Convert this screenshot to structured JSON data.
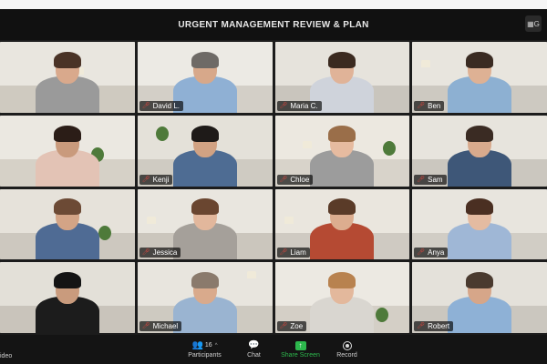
{
  "window": {
    "title": "URGENT MANAGEMENT REVIEW & PLAN",
    "view_button_label": "G"
  },
  "participants": [
    {
      "name": "",
      "muted": false,
      "active": false,
      "wall": "#e9e6df",
      "floor": "#cfcac0",
      "skin": "#d9a98c",
      "hair": "#4a3326",
      "shirt": "#9a9a9a"
    },
    {
      "name": "David L.",
      "muted": true,
      "active": true,
      "wall": "#eceae4",
      "floor": "#d3cfc7",
      "skin": "#d7a88a",
      "hair": "#6e6a66",
      "shirt": "#8fb0d4"
    },
    {
      "name": "Maria C.",
      "muted": true,
      "active": false,
      "wall": "#e6e3dc",
      "floor": "#c9c5bd",
      "skin": "#e0b398",
      "hair": "#3b2a20",
      "shirt": "#cfd3db"
    },
    {
      "name": "Ben",
      "muted": true,
      "active": false,
      "wall": "#e8e5de",
      "floor": "#cdc9c1",
      "skin": "#deb194",
      "hair": "#3a2b22",
      "shirt": "#8db0d2"
    },
    {
      "name": "",
      "muted": false,
      "active": false,
      "wall": "#ebe8e1",
      "floor": "#d6d1c7",
      "skin": "#c99a7c",
      "hair": "#2b1d17",
      "shirt": "#e3c3b5"
    },
    {
      "name": "Kenji",
      "muted": true,
      "active": false,
      "wall": "#e4e1d9",
      "floor": "#cfcbc2",
      "skin": "#d1a283",
      "hair": "#1e1a18",
      "shirt": "#4e6c93"
    },
    {
      "name": "Chloe",
      "muted": true,
      "active": false,
      "wall": "#ece8e0",
      "floor": "#d8d3ca",
      "skin": "#e6bba0",
      "hair": "#9a6e49",
      "shirt": "#9c9c9c"
    },
    {
      "name": "Sam",
      "muted": true,
      "active": false,
      "wall": "#e7e4dd",
      "floor": "#cbc7bf",
      "skin": "#d8aa8d",
      "hair": "#3a2b23",
      "shirt": "#3e5778"
    },
    {
      "name": "",
      "muted": false,
      "active": false,
      "wall": "#e6e2da",
      "floor": "#cdc8bf",
      "skin": "#d3a486",
      "hair": "#6c4a35",
      "shirt": "#4f6b94"
    },
    {
      "name": "Jessica",
      "muted": true,
      "active": false,
      "wall": "#e9e6df",
      "floor": "#cbc6bd",
      "skin": "#e2b79c",
      "hair": "#6a4630",
      "shirt": "#a5a09a"
    },
    {
      "name": "Liam",
      "muted": true,
      "active": false,
      "wall": "#eae6de",
      "floor": "#cfcac2",
      "skin": "#dcad8f",
      "hair": "#5a3b28",
      "shirt": "#b54a33"
    },
    {
      "name": "Anya",
      "muted": true,
      "active": false,
      "wall": "#e8e5de",
      "floor": "#d1cdc5",
      "skin": "#e4bba1",
      "hair": "#4a2f22",
      "shirt": "#9fb7d6"
    },
    {
      "name": "",
      "muted": false,
      "active": false,
      "wall": "#e3e0d8",
      "floor": "#c9c4bb",
      "skin": "#c99b7d",
      "hair": "#141414",
      "shirt": "#1c1c1c"
    },
    {
      "name": "Michael",
      "muted": true,
      "active": false,
      "wall": "#e8e5de",
      "floor": "#cecac1",
      "skin": "#d9aa8c",
      "hair": "#8a7a6c",
      "shirt": "#9ab4d1"
    },
    {
      "name": "Zoe",
      "muted": true,
      "active": false,
      "wall": "#ece9e2",
      "floor": "#d4cfc6",
      "skin": "#e3b89c",
      "hair": "#b8824f",
      "shirt": "#d9d6d0"
    },
    {
      "name": "Robert",
      "muted": true,
      "active": false,
      "wall": "#e4e1da",
      "floor": "#cbc7bf",
      "skin": "#d6a689",
      "hair": "#4a3a2f",
      "shirt": "#8eb1d6"
    }
  ],
  "toolbar": {
    "video_label": "ideo",
    "participants_label": "Participants",
    "participants_count": "16",
    "chat_label": "Chat",
    "share_label": "Share Screen",
    "record_label": "Record"
  },
  "colors": {
    "share_green": "#2db84d",
    "active_speaker": "#c9d84a",
    "muted_red": "#e0463e"
  }
}
